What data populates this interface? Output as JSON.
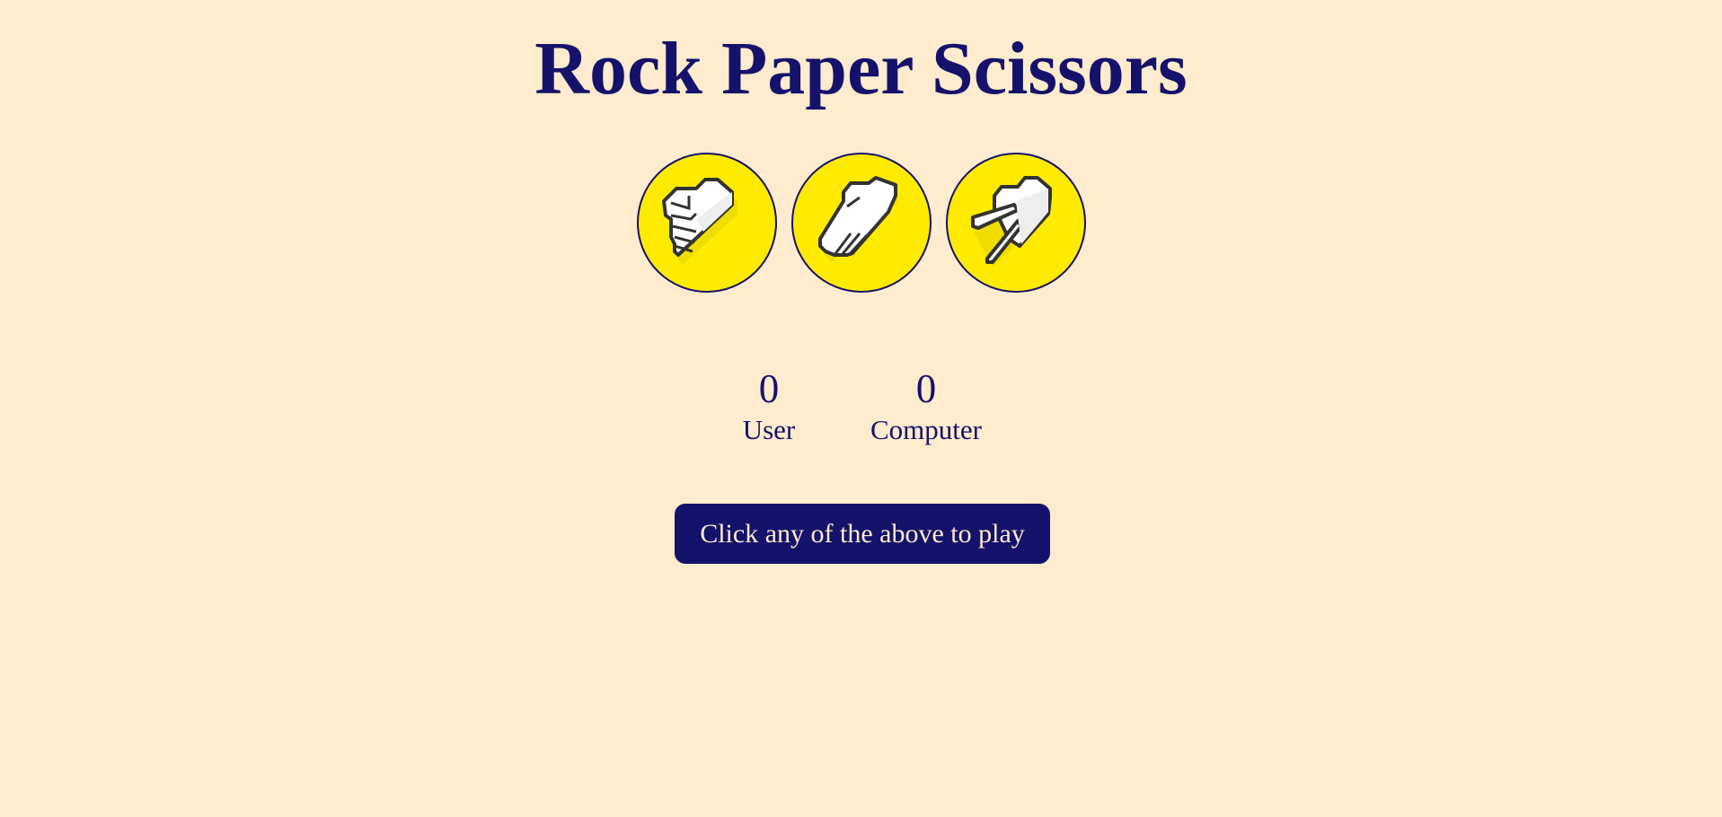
{
  "title": "Rock Paper Scissors",
  "choices": [
    {
      "name": "rock",
      "icon": "rock-hand-icon"
    },
    {
      "name": "paper",
      "icon": "paper-hand-icon"
    },
    {
      "name": "scissors",
      "icon": "scissors-hand-icon"
    }
  ],
  "scoreboard": {
    "user": {
      "score": "0",
      "label": "User"
    },
    "computer": {
      "score": "0",
      "label": "Computer"
    }
  },
  "message": "Click any of the above to play",
  "colors": {
    "background": "#ffebcd",
    "primary": "#14126b",
    "circle": "#ffeb00"
  }
}
